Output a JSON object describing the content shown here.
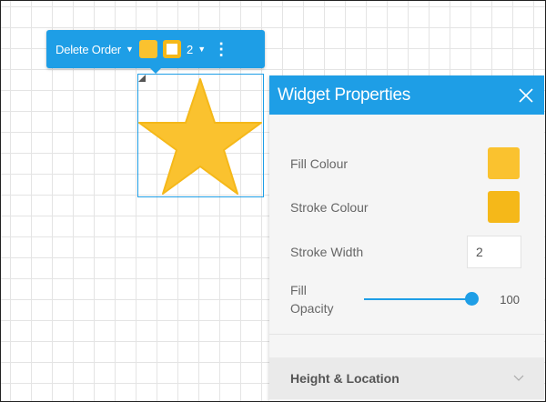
{
  "toolbar": {
    "action_label": "Delete Order",
    "width_value": "2",
    "fill_color": "#fac22f",
    "stroke_color": "#f5b819"
  },
  "panel": {
    "title": "Widget Properties",
    "fill_colour_label": "Fill Colour",
    "fill_colour": "#fac22f",
    "stroke_colour_label": "Stroke Colour",
    "stroke_colour": "#f5b819",
    "stroke_width_label": "Stroke Width",
    "stroke_width_value": "2",
    "fill_opacity_label_line1": "Fill",
    "fill_opacity_label_line2": "Opacity",
    "fill_opacity_value": "100",
    "section_label": "Height & Location"
  },
  "widget": {
    "shape": "star-icon",
    "fill": "#fac22f",
    "stroke": "#f5b819"
  },
  "colors": {
    "accent": "#1e9ee6",
    "panel_bg": "#f5f5f5",
    "grid_line": "#e4e4e4"
  }
}
